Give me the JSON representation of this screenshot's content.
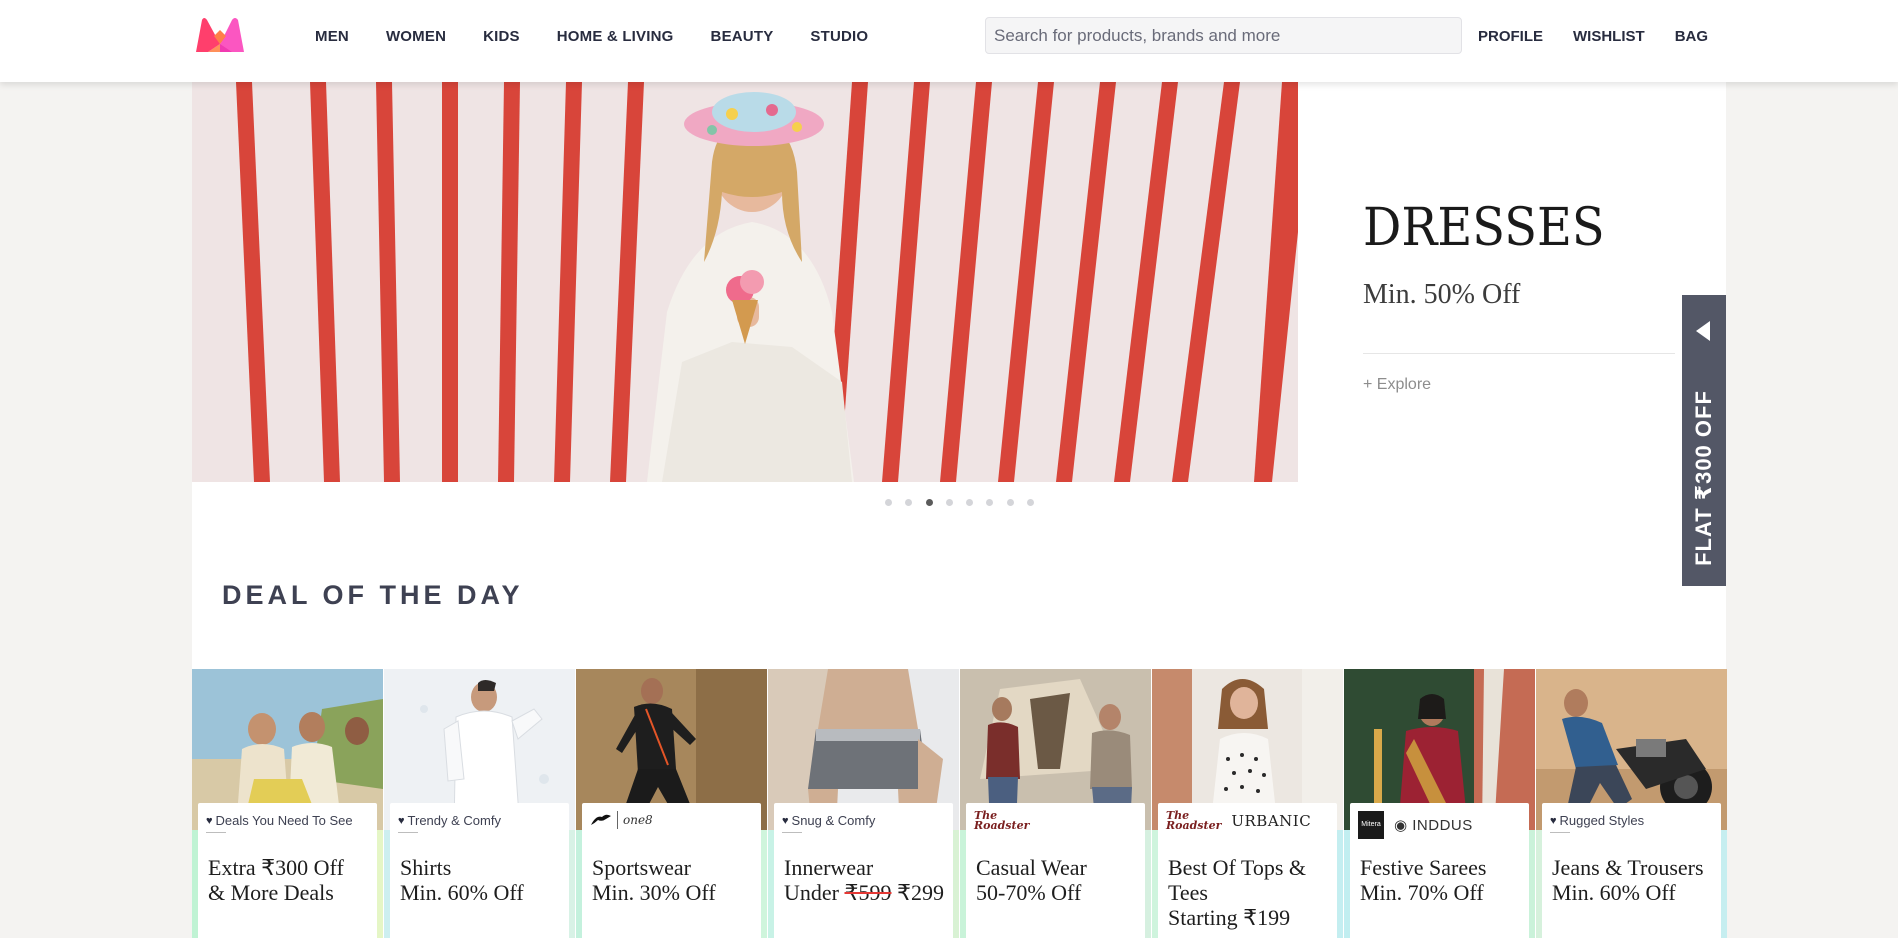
{
  "header": {
    "logo_alt": "Myntra",
    "nav": [
      "MEN",
      "WOMEN",
      "KIDS",
      "HOME & LIVING",
      "BEAUTY",
      "STUDIO"
    ],
    "search_placeholder": "Search for products, brands and more",
    "actions": [
      "PROFILE",
      "WISHLIST",
      "BAG"
    ]
  },
  "banner": {
    "title": "DRESSES",
    "subtitle": "Min. 50% Off",
    "cta": "+ Explore",
    "dots_total": 8,
    "dots_active_index": 2
  },
  "coupon_tab": {
    "label": "FLAT ₹300 OFF"
  },
  "deal_section": {
    "title": "DEAL OF THE DAY",
    "cards": [
      {
        "tag": "Deals You Need To See",
        "line1": "Extra ₹300 Off",
        "line2": "& More Deals"
      },
      {
        "tag": "Trendy & Comfy",
        "line1": "Shirts",
        "line2": "Min. 60% Off"
      },
      {
        "brand": "PUMA | one8",
        "line1": "Sportswear",
        "line2": "Min. 30% Off"
      },
      {
        "tag": "Snug & Comfy",
        "line1": "Innerwear",
        "line2_prefix": "Under ",
        "line2_strike": "₹599",
        "line2_suffix": " ₹299"
      },
      {
        "brand": "The Roadster Life Co.",
        "line1": "Casual Wear",
        "line2": "50-70% Off"
      },
      {
        "brand": "The Roadster Life Co. | URBANIC",
        "line1": "Best Of Tops & Tees",
        "line2": "Starting ₹199"
      },
      {
        "brand": "Mitera | INDDUS",
        "line1": "Festive Sarees",
        "line2": "Min. 70% Off"
      },
      {
        "tag": "Rugged Styles",
        "line1": "Jeans & Trousers",
        "line2": "Min. 60% Off"
      }
    ]
  },
  "colors": {
    "nav_text": "#282c3f",
    "section_title": "#3e4152",
    "coupon_bg": "#535766",
    "stripe_red": "#d8453a",
    "band_mint": "#c8f2d8"
  }
}
